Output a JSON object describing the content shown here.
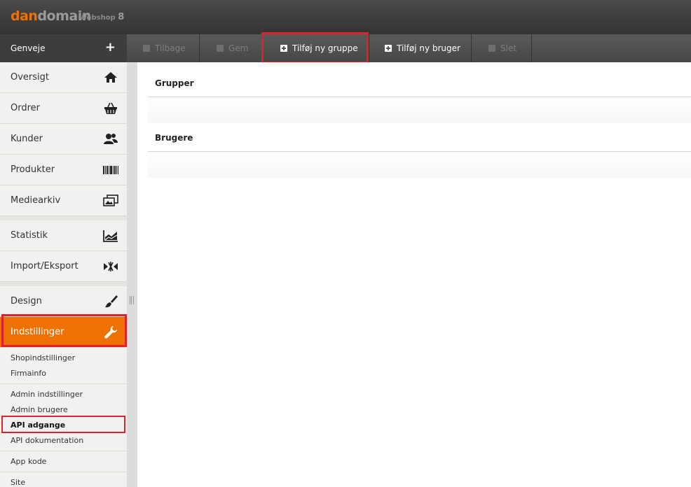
{
  "header": {
    "logo_part1": "dan",
    "logo_part2": "domain",
    "product": "Webshop",
    "version": "8"
  },
  "sidebar": {
    "shortcuts_label": "Genveje",
    "shortcuts_add": "+",
    "items": [
      {
        "label": "Oversigt",
        "icon": "home-icon"
      },
      {
        "label": "Ordrer",
        "icon": "basket-icon"
      },
      {
        "label": "Kunder",
        "icon": "users-icon"
      },
      {
        "label": "Produkter",
        "icon": "barcode-icon"
      },
      {
        "label": "Mediearkiv",
        "icon": "images-icon"
      },
      {
        "label": "Statistik",
        "icon": "chart-icon"
      },
      {
        "label": "Import/Eksport",
        "icon": "import-export-icon"
      },
      {
        "label": "Design",
        "icon": "brush-icon"
      },
      {
        "label": "Indstillinger",
        "icon": "wrench-icon"
      }
    ],
    "sub_groups": [
      [
        "Shopindstillinger",
        "Firmainfo"
      ],
      [
        "Admin indstillinger",
        "Admin brugere",
        "API adgange",
        "API dokumentation"
      ],
      [
        "App kode"
      ],
      [
        "Site"
      ]
    ]
  },
  "toolbar": {
    "back": "Tilbage",
    "save": "Gem",
    "add_group": "Tilføj ny gruppe",
    "add_user": "Tilføj ny bruger",
    "delete": "Slet"
  },
  "main": {
    "groups_title": "Grupper",
    "users_title": "Brugere"
  },
  "colors": {
    "accent": "#ee7203",
    "highlight": "#e0212c",
    "header": "#3d3d3d"
  }
}
